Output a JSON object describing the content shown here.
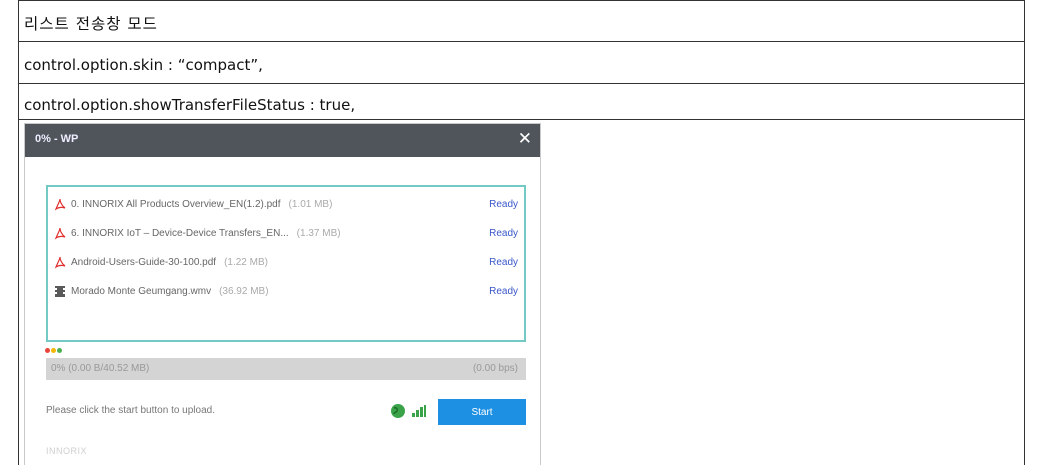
{
  "document": {
    "heading": "리스트 전송창 모드",
    "option_skin": "control.option.skin : “compact”,",
    "option_status": "control.option.showTransferFileStatus : true,"
  },
  "dialog": {
    "title": "0% - WP",
    "close_label": "✕",
    "files": [
      {
        "name": "0. INNORIX All Products Overview_EN(1.2).pdf",
        "size": "(1.01 MB)",
        "status": "Ready",
        "icon": "pdf-icon"
      },
      {
        "name": "6. INNORIX IoT – Device-Device Transfers_EN...",
        "size": "(1.37 MB)",
        "status": "Ready",
        "icon": "pdf-icon"
      },
      {
        "name": "Android-Users-Guide-30-100.pdf",
        "size": "(1.22 MB)",
        "status": "Ready",
        "icon": "pdf-icon"
      },
      {
        "name": "Morado Monte Geumgang.wmv",
        "size": "(36.92 MB)",
        "status": "Ready",
        "icon": "video-file-icon"
      }
    ],
    "status_dot_colors": [
      "#e8453c",
      "#f2b705",
      "#4caf50"
    ],
    "progress": {
      "percent": 0,
      "left_text": "0% (0.00 B/40.52 MB)",
      "right_text": "(0.00 bps)"
    },
    "hint": "Please click the start button to upload.",
    "start_label": "Start",
    "brand": "INNORIX",
    "colors": {
      "titlebar": "#50545b",
      "list_border": "#73c9c4",
      "accent": "#1e90e3",
      "status_text": "#3a57c9"
    }
  }
}
